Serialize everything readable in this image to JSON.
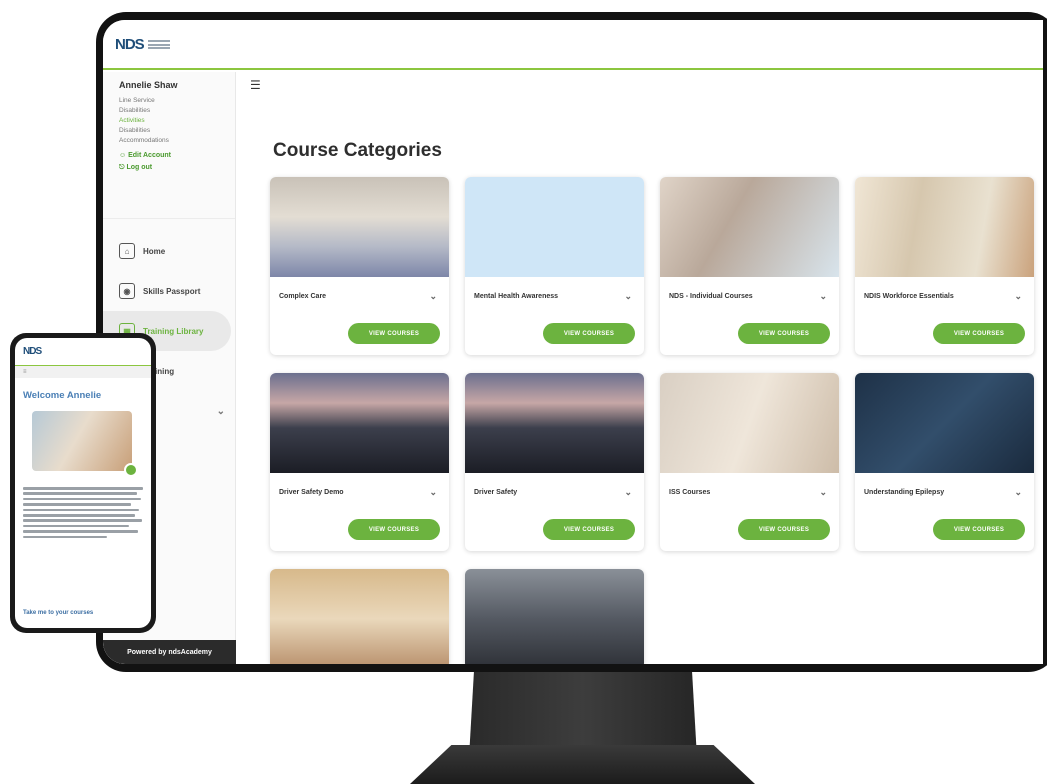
{
  "brand": {
    "logo_text": "NDS"
  },
  "sidebar": {
    "user_name": "Annelie Shaw",
    "user_lines": [
      {
        "text": "Line Service",
        "accent": false
      },
      {
        "text": "Disabilities",
        "accent": false
      },
      {
        "text": "Activities",
        "accent": true
      },
      {
        "text": "Disabilities",
        "accent": false
      },
      {
        "text": "Accommodations",
        "accent": false
      }
    ],
    "edit_account": "Edit Account",
    "logout": "Log out",
    "nav": [
      {
        "label": "Home",
        "icon": "home-icon"
      },
      {
        "label": "Skills Passport",
        "icon": "passport-icon"
      },
      {
        "label": "Training Library",
        "icon": "library-icon"
      },
      {
        "label": "Training",
        "icon": "training-icon"
      },
      {
        "label": "",
        "icon": "more-icon"
      }
    ],
    "powered_by": "Powered by ndsAcademy"
  },
  "main": {
    "page_title": "Course Categories",
    "button_label": "VIEW COURSES",
    "cards": [
      {
        "title": "Complex Care",
        "thumb": "t-hosp"
      },
      {
        "title": "Mental Health Awareness",
        "thumb": "t-illus"
      },
      {
        "title": "NDS - Individual Courses",
        "thumb": "t-care1"
      },
      {
        "title": "NDIS Workforce Essentials",
        "thumb": "t-ndis"
      },
      {
        "title": "Driver Safety Demo",
        "thumb": "t-drive"
      },
      {
        "title": "Driver Safety",
        "thumb": "t-drive"
      },
      {
        "title": "ISS Courses",
        "thumb": "t-care2"
      },
      {
        "title": "Understanding Epilepsy",
        "thumb": "t-brain"
      },
      {
        "title": "",
        "thumb": "t-elder"
      },
      {
        "title": "",
        "thumb": "t-crowd"
      }
    ]
  },
  "phone": {
    "logo_text": "NDS",
    "menu_label": "≡",
    "welcome": "Welcome Annelie",
    "link": "Take me to your courses"
  },
  "colors": {
    "accent_green": "#6cb33f",
    "brand_blue": "#1f4e79"
  }
}
